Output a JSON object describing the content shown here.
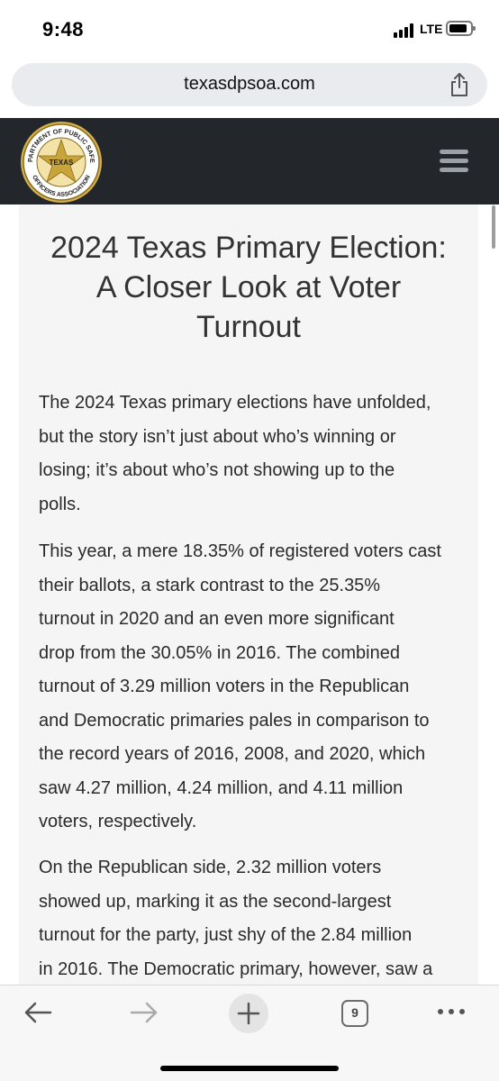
{
  "status_bar": {
    "time": "9:48",
    "network": "LTE"
  },
  "browser": {
    "url": "texasdpsoa.com",
    "tab_count": "9",
    "icons": {
      "share": "share-icon",
      "back": "back-arrow-icon",
      "forward": "forward-arrow-icon",
      "new_tab": "plus-icon",
      "more": "more-dots-icon"
    }
  },
  "site": {
    "logo": {
      "top_text": "DEPARTMENT OF PUBLIC SAFETY",
      "center_text": "TEXAS",
      "bottom_text": "OFFICERS ASSOCIATION"
    },
    "menu_icon": "hamburger-menu-icon",
    "colors": {
      "header_bg": "#23272b",
      "logo_gold": "#c9a43a"
    }
  },
  "article": {
    "title_lines": [
      "2024 Texas Primary Election:",
      "A Closer Look at Voter",
      "Turnout"
    ],
    "paragraphs": [
      [
        "The 2024 Texas primary elections have unfolded,",
        "but the story isn’t just about who’s winning or",
        "losing; it’s about who’s not showing up to the",
        "polls."
      ],
      [
        "This year, a mere 18.35% of registered voters cast",
        "their ballots, a stark contrast to the 25.35%",
        "turnout in 2020 and an even more significant",
        "drop from the 30.05% in 2016. The combined",
        "turnout of 3.29 million voters in the Republican",
        "and Democratic primaries pales in comparison to",
        "the record years of 2016, 2008, and 2020, which",
        "saw 4.27 million, 4.24 million, and 4.11 million",
        "voters, respectively."
      ],
      [
        "On the Republican side, 2.32 million voters",
        "showed up, marking it as the second-largest",
        "turnout for the party, just shy of the 2.84 million",
        "in 2016. The Democratic primary, however, saw a"
      ]
    ]
  }
}
